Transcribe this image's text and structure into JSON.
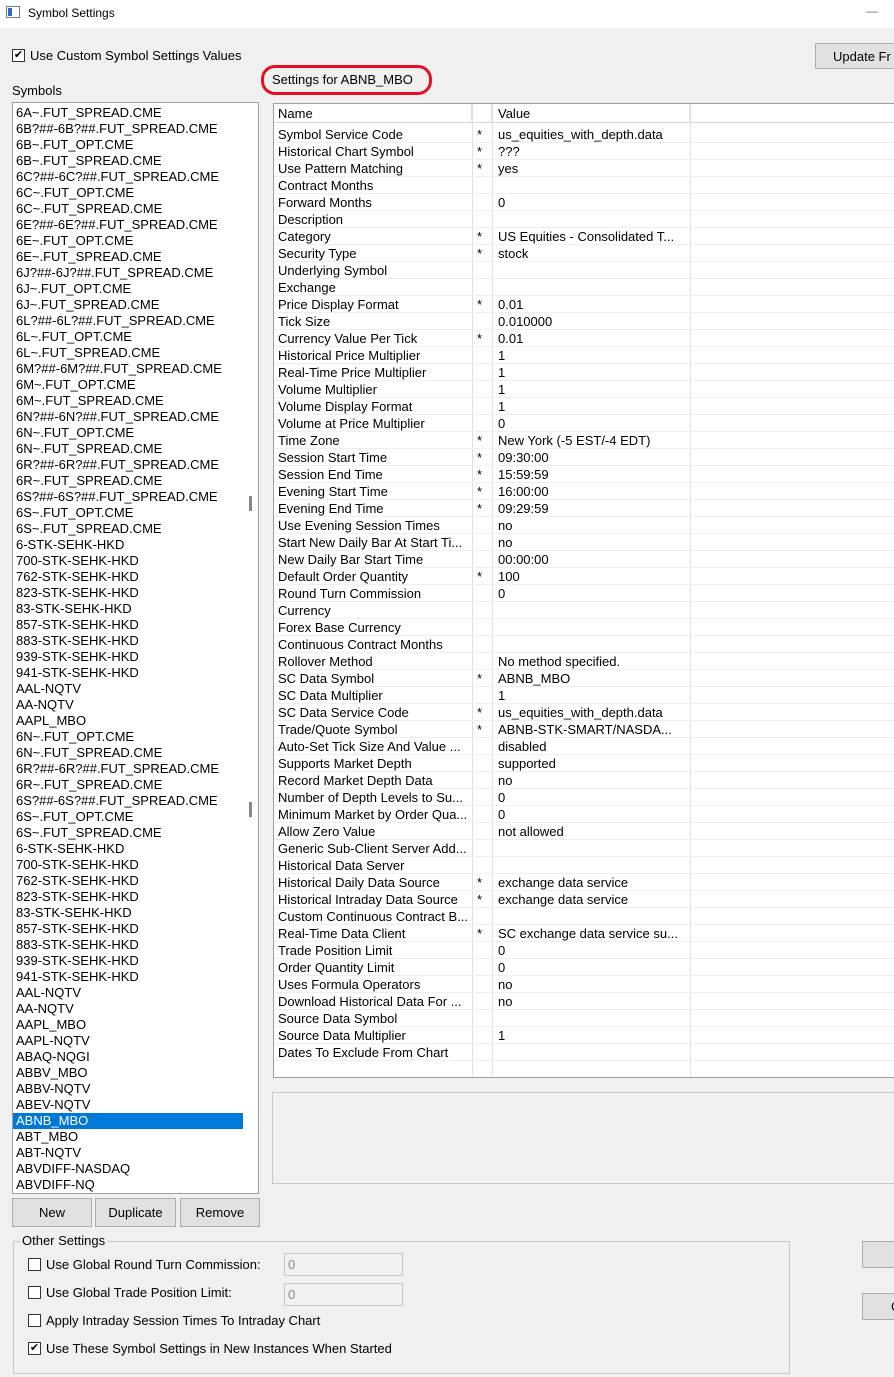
{
  "window": {
    "title": "Symbol Settings"
  },
  "top": {
    "use_custom_label": "Use Custom Symbol Settings Values",
    "use_custom_checked": "✔",
    "update_button": "Update Fr"
  },
  "symbols": {
    "label": "Symbols",
    "items": [
      "6A~.FUT_SPREAD.CME",
      "6B?##-6B?##.FUT_SPREAD.CME",
      "6B~.FUT_OPT.CME",
      "6B~.FUT_SPREAD.CME",
      "6C?##-6C?##.FUT_SPREAD.CME",
      "6C~.FUT_OPT.CME",
      "6C~.FUT_SPREAD.CME",
      "6E?##-6E?##.FUT_SPREAD.CME",
      "6E~.FUT_OPT.CME",
      "6E~.FUT_SPREAD.CME",
      "6J?##-6J?##.FUT_SPREAD.CME",
      "6J~.FUT_OPT.CME",
      "6J~.FUT_SPREAD.CME",
      "6L?##-6L?##.FUT_SPREAD.CME",
      "6L~.FUT_OPT.CME",
      "6L~.FUT_SPREAD.CME",
      "6M?##-6M?##.FUT_SPREAD.CME",
      "6M~.FUT_OPT.CME",
      "6M~.FUT_SPREAD.CME",
      "6N?##-6N?##.FUT_SPREAD.CME",
      "6N~.FUT_OPT.CME",
      "6N~.FUT_SPREAD.CME",
      "6R?##-6R?##.FUT_SPREAD.CME",
      "6R~.FUT_SPREAD.CME",
      "6S?##-6S?##.FUT_SPREAD.CME",
      "6S~.FUT_OPT.CME",
      "6S~.FUT_SPREAD.CME",
      "6-STK-SEHK-HKD",
      "700-STK-SEHK-HKD",
      "762-STK-SEHK-HKD",
      "823-STK-SEHK-HKD",
      "83-STK-SEHK-HKD",
      "857-STK-SEHK-HKD",
      "883-STK-SEHK-HKD",
      "939-STK-SEHK-HKD",
      "941-STK-SEHK-HKD",
      "AAL-NQTV",
      "AA-NQTV",
      "AAPL_MBO",
      "6N~.FUT_OPT.CME",
      "6N~.FUT_SPREAD.CME",
      "6R?##-6R?##.FUT_SPREAD.CME",
      "6R~.FUT_SPREAD.CME",
      "6S?##-6S?##.FUT_SPREAD.CME",
      "6S~.FUT_OPT.CME",
      "6S~.FUT_SPREAD.CME",
      "6-STK-SEHK-HKD",
      "700-STK-SEHK-HKD",
      "762-STK-SEHK-HKD",
      "823-STK-SEHK-HKD",
      "83-STK-SEHK-HKD",
      "857-STK-SEHK-HKD",
      "883-STK-SEHK-HKD",
      "939-STK-SEHK-HKD",
      "941-STK-SEHK-HKD",
      "AAL-NQTV",
      "AA-NQTV",
      "AAPL_MBO",
      "AAPL-NQTV",
      "ABAQ-NQGI",
      "ABBV_MBO",
      "ABBV-NQTV",
      "ABEV-NQTV",
      "ABNB_MBO",
      "ABT_MBO",
      "ABT-NQTV",
      "ABVDIFF-NASDAQ",
      "ABVDIFF-NQ"
    ],
    "selected_index": 63,
    "buttons": {
      "new": "New",
      "duplicate": "Duplicate",
      "remove": "Remove"
    }
  },
  "settings": {
    "title": "Settings for ABNB_MBO",
    "columns": {
      "name": "Name",
      "value": "Value"
    },
    "rows": [
      {
        "name": "Symbol Service Code",
        "star": "*",
        "value": "us_equities_with_depth.data"
      },
      {
        "name": "Historical Chart Symbol",
        "star": "*",
        "value": "???"
      },
      {
        "name": "Use Pattern Matching",
        "star": "*",
        "value": "yes"
      },
      {
        "name": "Contract Months",
        "star": "",
        "value": ""
      },
      {
        "name": "Forward Months",
        "star": "",
        "value": "0"
      },
      {
        "name": "Description",
        "star": "",
        "value": ""
      },
      {
        "name": "Category",
        "star": "*",
        "value": "US Equities - Consolidated T..."
      },
      {
        "name": "Security Type",
        "star": "*",
        "value": "stock"
      },
      {
        "name": "Underlying Symbol",
        "star": "",
        "value": ""
      },
      {
        "name": "Exchange",
        "star": "",
        "value": ""
      },
      {
        "name": "Price Display Format",
        "star": "*",
        "value": "0.01"
      },
      {
        "name": "Tick Size",
        "star": "",
        "value": "0.010000"
      },
      {
        "name": "Currency Value Per Tick",
        "star": "*",
        "value": "0.01"
      },
      {
        "name": "Historical Price Multiplier",
        "star": "",
        "value": "1"
      },
      {
        "name": "Real-Time Price Multiplier",
        "star": "",
        "value": "1"
      },
      {
        "name": "Volume Multiplier",
        "star": "",
        "value": "1"
      },
      {
        "name": "Volume Display Format",
        "star": "",
        "value": "1"
      },
      {
        "name": "Volume at Price Multiplier",
        "star": "",
        "value": "0"
      },
      {
        "name": "Time Zone",
        "star": "*",
        "value": "New York (-5 EST/-4 EDT)"
      },
      {
        "name": "Session Start Time",
        "star": "*",
        "value": "09:30:00"
      },
      {
        "name": "Session End Time",
        "star": "*",
        "value": "15:59:59"
      },
      {
        "name": "Evening Start Time",
        "star": "*",
        "value": "16:00:00"
      },
      {
        "name": "Evening End Time",
        "star": "*",
        "value": "09:29:59"
      },
      {
        "name": "Use Evening Session Times",
        "star": "",
        "value": "no"
      },
      {
        "name": "Start New Daily Bar At Start Ti...",
        "star": "",
        "value": "no"
      },
      {
        "name": "New Daily Bar Start Time",
        "star": "",
        "value": "00:00:00"
      },
      {
        "name": "Default Order Quantity",
        "star": "*",
        "value": "100"
      },
      {
        "name": "Round Turn Commission",
        "star": "",
        "value": "0"
      },
      {
        "name": "Currency",
        "star": "",
        "value": ""
      },
      {
        "name": "Forex Base Currency",
        "star": "",
        "value": ""
      },
      {
        "name": "Continuous Contract Months",
        "star": "",
        "value": ""
      },
      {
        "name": "Rollover Method",
        "star": "",
        "value": "No method specified."
      },
      {
        "name": "SC Data Symbol",
        "star": "*",
        "value": "ABNB_MBO"
      },
      {
        "name": "SC Data Multiplier",
        "star": "",
        "value": "1"
      },
      {
        "name": "SC Data Service Code",
        "star": "*",
        "value": "us_equities_with_depth.data"
      },
      {
        "name": "Trade/Quote Symbol",
        "star": "*",
        "value": "ABNB-STK-SMART/NASDA..."
      },
      {
        "name": "Auto-Set Tick Size And Value ...",
        "star": "",
        "value": "disabled"
      },
      {
        "name": "Supports Market Depth",
        "star": "",
        "value": "supported"
      },
      {
        "name": "Record Market Depth Data",
        "star": "",
        "value": "no"
      },
      {
        "name": "Number of Depth Levels to Su...",
        "star": "",
        "value": "0"
      },
      {
        "name": "Minimum Market by Order Qua...",
        "star": "",
        "value": "0"
      },
      {
        "name": "Allow Zero Value",
        "star": "",
        "value": "not allowed"
      },
      {
        "name": "Generic Sub-Client Server Add...",
        "star": "",
        "value": ""
      },
      {
        "name": "Historical Data Server",
        "star": "",
        "value": ""
      },
      {
        "name": "Historical Daily Data Source",
        "star": "*",
        "value": "exchange data service"
      },
      {
        "name": "Historical Intraday Data Source",
        "star": "*",
        "value": "exchange data service"
      },
      {
        "name": "Custom Continuous Contract B...",
        "star": "",
        "value": ""
      },
      {
        "name": "Real-Time Data Client",
        "star": "*",
        "value": "SC exchange data service su..."
      },
      {
        "name": "Trade Position Limit",
        "star": "",
        "value": "0"
      },
      {
        "name": "Order Quantity Limit",
        "star": "",
        "value": "0"
      },
      {
        "name": "Uses Formula Operators",
        "star": "",
        "value": "no"
      },
      {
        "name": "Download Historical Data For ...",
        "star": "",
        "value": "no"
      },
      {
        "name": "Source Data Symbol",
        "star": "",
        "value": ""
      },
      {
        "name": "Source Data Multiplier",
        "star": "",
        "value": "1"
      },
      {
        "name": "Dates To Exclude From Chart",
        "star": "",
        "value": ""
      }
    ]
  },
  "other_settings": {
    "title": "Other Settings",
    "global_commission": {
      "label": "Use Global Round Turn Commission:",
      "value": "0",
      "checked": ""
    },
    "global_position_limit": {
      "label": "Use Global Trade Position Limit:",
      "value": "0",
      "checked": ""
    },
    "apply_intraday": {
      "label": "Apply Intraday Session Times To Intraday Chart",
      "checked": ""
    },
    "use_in_new": {
      "label": "Use These Symbol Settings in New Instances When Started",
      "checked": "✔"
    },
    "right_button_2": "C"
  }
}
